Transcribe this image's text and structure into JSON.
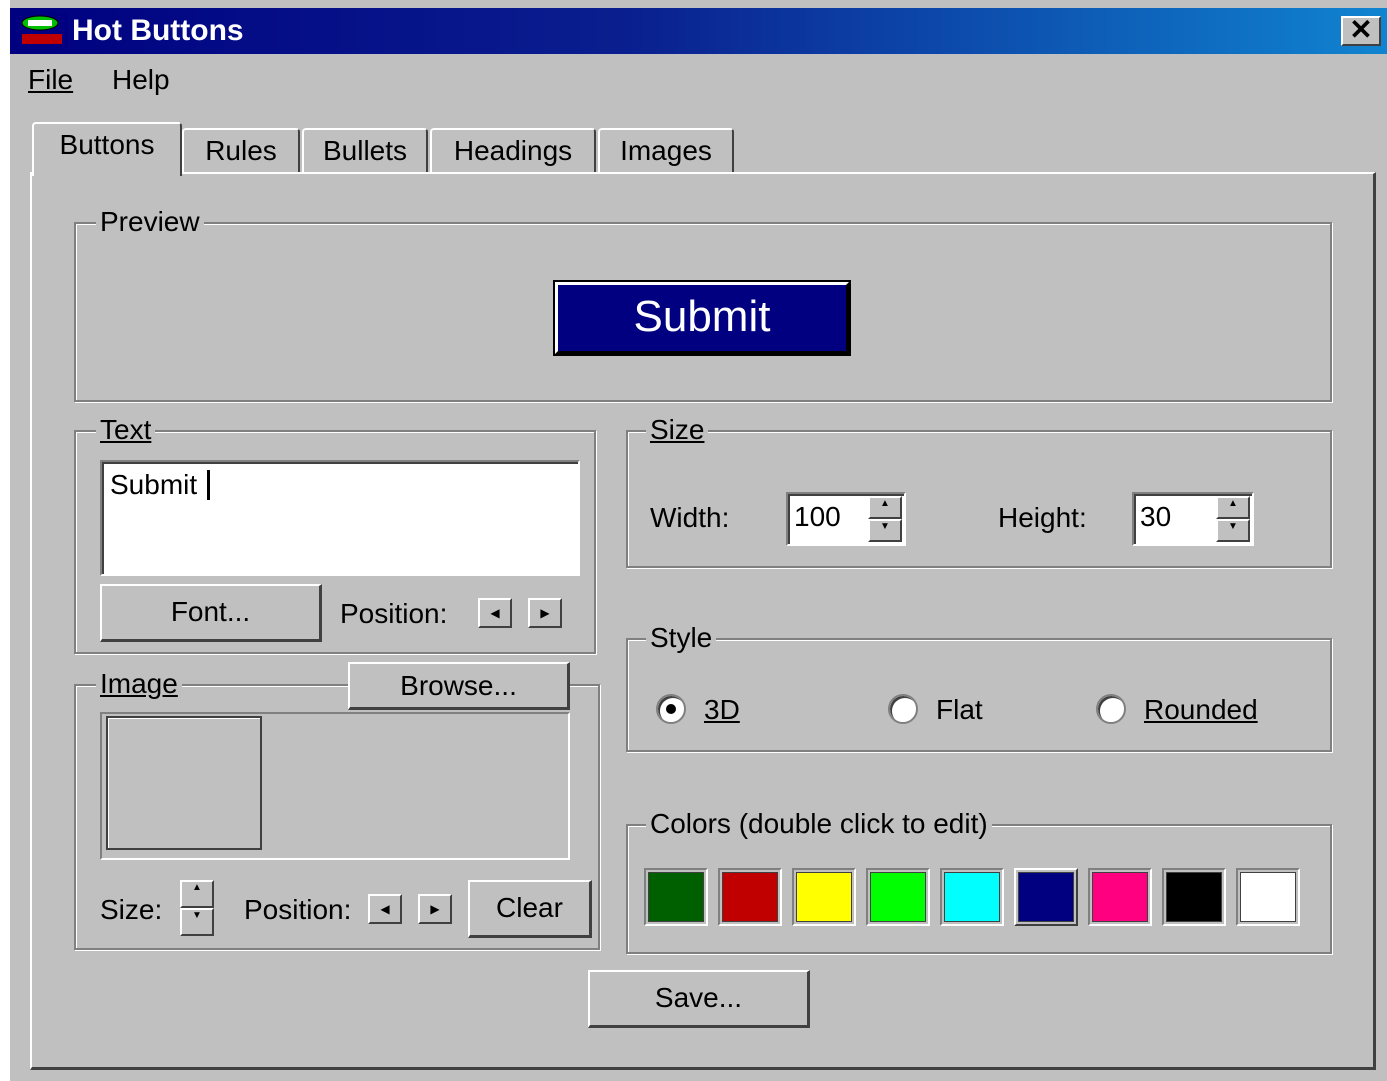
{
  "window": {
    "title": "Hot Buttons",
    "close_glyph": "✕"
  },
  "menu": {
    "file": "File",
    "help": "Help"
  },
  "tabs": [
    "Buttons",
    "Rules",
    "Bullets",
    "Headings",
    "Images"
  ],
  "active_tab": "Buttons",
  "preview": {
    "label": "Preview",
    "button_text": "Submit",
    "button_color": "#000080"
  },
  "text_group": {
    "label": "Text",
    "value": "Submit",
    "font_button": "Font...",
    "position_label": "Position:"
  },
  "image_group": {
    "label": "Image",
    "browse_button": "Browse...",
    "size_label": "Size:",
    "position_label": "Position:",
    "clear_button": "Clear"
  },
  "size_group": {
    "label": "Size",
    "width_label": "Width:",
    "width_value": "100",
    "height_label": "Height:",
    "height_value": "30"
  },
  "style_group": {
    "label": "Style",
    "options": [
      "3D",
      "Flat",
      "Rounded"
    ],
    "selected": "3D"
  },
  "colors_group": {
    "label": "Colors (double click to edit)",
    "swatches": [
      "#006000",
      "#c00000",
      "#ffff00",
      "#00ff00",
      "#00ffff",
      "#000080",
      "#ff0080",
      "#000000",
      "#ffffff"
    ],
    "selected": "#000080"
  },
  "save_button": "Save...",
  "icons": {
    "app": "chip-icon",
    "close": "close-icon",
    "spin_up": "▲",
    "spin_down": "▼",
    "left": "◀",
    "right": "▶"
  }
}
